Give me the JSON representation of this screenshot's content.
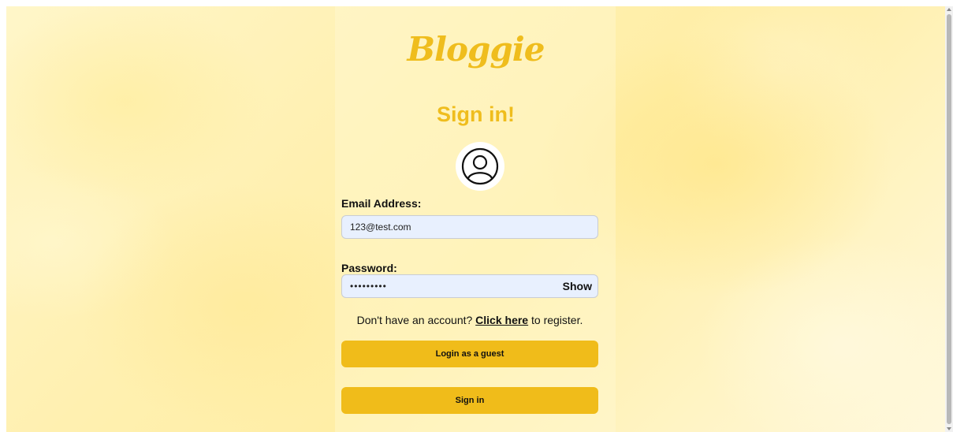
{
  "brand": {
    "logo_text": "Bloggie",
    "accent_color": "#efbd1d"
  },
  "signin": {
    "heading": "Sign in!",
    "avatar_icon": "user-circle-icon",
    "email_label": "Email Address:",
    "email_value": "123@test.com",
    "password_label": "Password:",
    "password_value": "•••••••••",
    "show_label": "Show",
    "register_prefix": "Don't have an account? ",
    "register_link": "Click here",
    "register_suffix": " to register.",
    "guest_button": "Login as a guest",
    "signin_button": "Sign in",
    "button_color": "#f0bc1a"
  }
}
